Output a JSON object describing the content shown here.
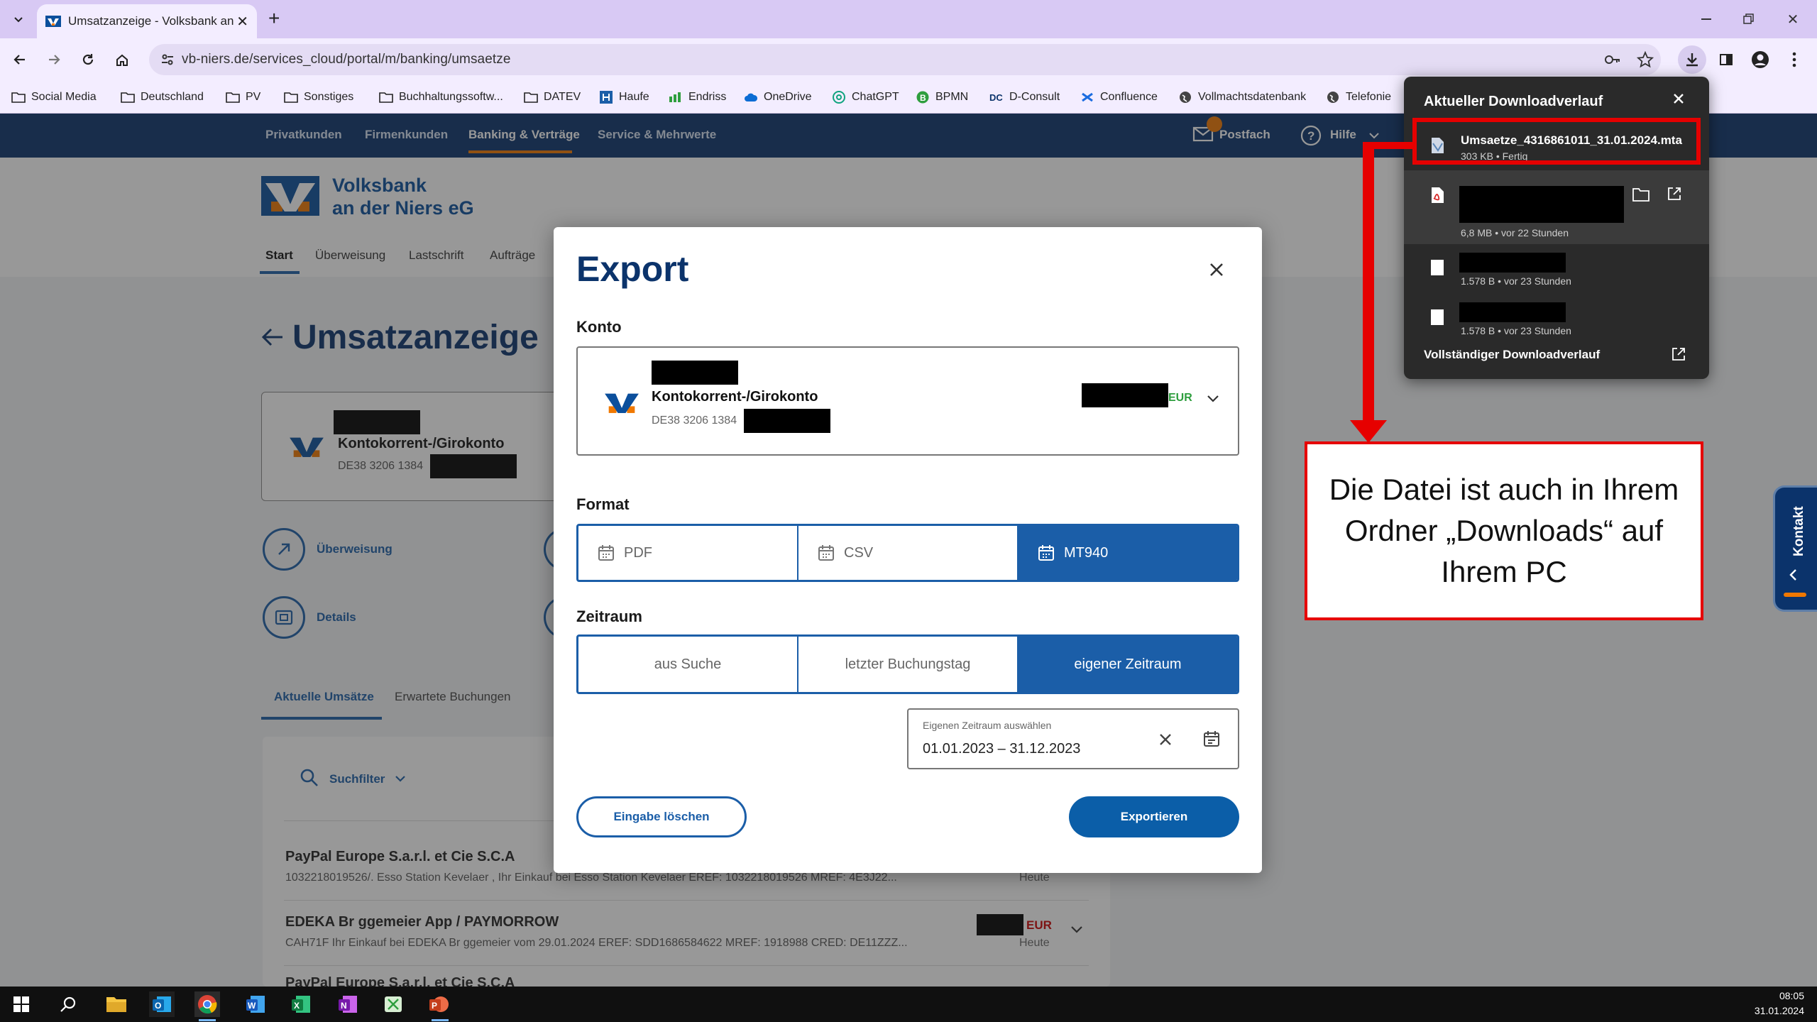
{
  "browser": {
    "tab_title": "Umsatzanzeige - Volksbank an",
    "url": "vb-niers.de/services_cloud/portal/m/banking/umsaetze",
    "bookmarks": [
      "Social Media",
      "Deutschland",
      "PV",
      "Sonstiges",
      "Buchhaltungssoftw...",
      "DATEV",
      "Haufe",
      "Endriss",
      "OneDrive",
      "ChatGPT",
      "BPMN",
      "D-Consult",
      "Confluence",
      "Vollmachtsdatenbank",
      "Telefonie"
    ]
  },
  "download_panel": {
    "title": "Aktueller Downloadverlauf",
    "items": [
      {
        "name": "Umsaetze_4316861011_31.01.2024.mta",
        "meta": "303 KB • Fertig"
      },
      {
        "name": "",
        "meta": "6,8 MB • vor 22 Stunden"
      },
      {
        "name": "",
        "meta": "1.578 B • vor 23 Stunden"
      },
      {
        "name": "",
        "meta": "1.578 B • vor 23 Stunden"
      }
    ],
    "footer": "Vollständiger Downloadverlauf"
  },
  "site": {
    "nav": [
      "Privatkunden",
      "Firmenkunden",
      "Banking & Verträge",
      "Service & Mehrwerte"
    ],
    "postfach": "Postfach",
    "hilfe": "Hilfe",
    "bank_name_1": "Volksbank",
    "bank_name_2": "an der Niers eG",
    "subnav": [
      "Start",
      "Überweisung",
      "Lastschrift",
      "Aufträge"
    ],
    "page_title": "Umsatzanzeige",
    "account_type": "Kontokorrent-/Girokonto",
    "iban_prefix": "DE38 3206 1384",
    "actions": [
      "Überweisung",
      "Details"
    ],
    "tabs": [
      "Aktuelle Umsätze",
      "Erwartete Buchungen"
    ],
    "suchfilter": "Suchfilter",
    "transactions": [
      {
        "title": "PayPal Europe S.a.r.l. et Cie S.C.A",
        "desc": "1032218019526/. Esso Station Kevelaer , Ihr Einkauf bei Esso Station Kevelaer EREF: 1032218019526 MREF: 4E3J22...",
        "currency": "",
        "when": "Heute"
      },
      {
        "title": "EDEKA Br ggemeier App / PAYMORROW",
        "desc": "CAH71F Ihr Einkauf bei EDEKA Br ggemeier vom 29.01.2024 EREF: SDD1686584622 MREF: 1918988 CRED: DE11ZZZ...",
        "currency": "EUR",
        "when": "Heute"
      },
      {
        "title": "PayPal Europe S.a.r.l. et Cie S.C.A",
        "desc": "",
        "currency": "",
        "when": ""
      }
    ]
  },
  "modal": {
    "title": "Export",
    "konto_label": "Konto",
    "account_type": "Kontokorrent-/Girokonto",
    "iban_prefix": "DE38 3206 1384",
    "currency": "EUR",
    "format_label": "Format",
    "formats": [
      "PDF",
      "CSV",
      "MT940"
    ],
    "selected_format": "MT940",
    "zeitraum_label": "Zeitraum",
    "zeitraum_options": [
      "aus Suche",
      "letzter Buchungstag",
      "eigener Zeitraum"
    ],
    "selected_zeitraum": "eigener Zeitraum",
    "date_field_label": "Eigenen Zeitraum auswählen",
    "date_range": "01.01.2023 – 31.12.2023",
    "clear_button": "Eingabe löschen",
    "export_button": "Exportieren"
  },
  "annotation": {
    "text": "Die Datei ist auch in Ihrem Ordner „Downloads“ auf Ihrem PC",
    "color": "#e60000"
  },
  "kontakt": "Kontakt",
  "clock": {
    "time": "08:05",
    "date": "31.01.2024"
  }
}
